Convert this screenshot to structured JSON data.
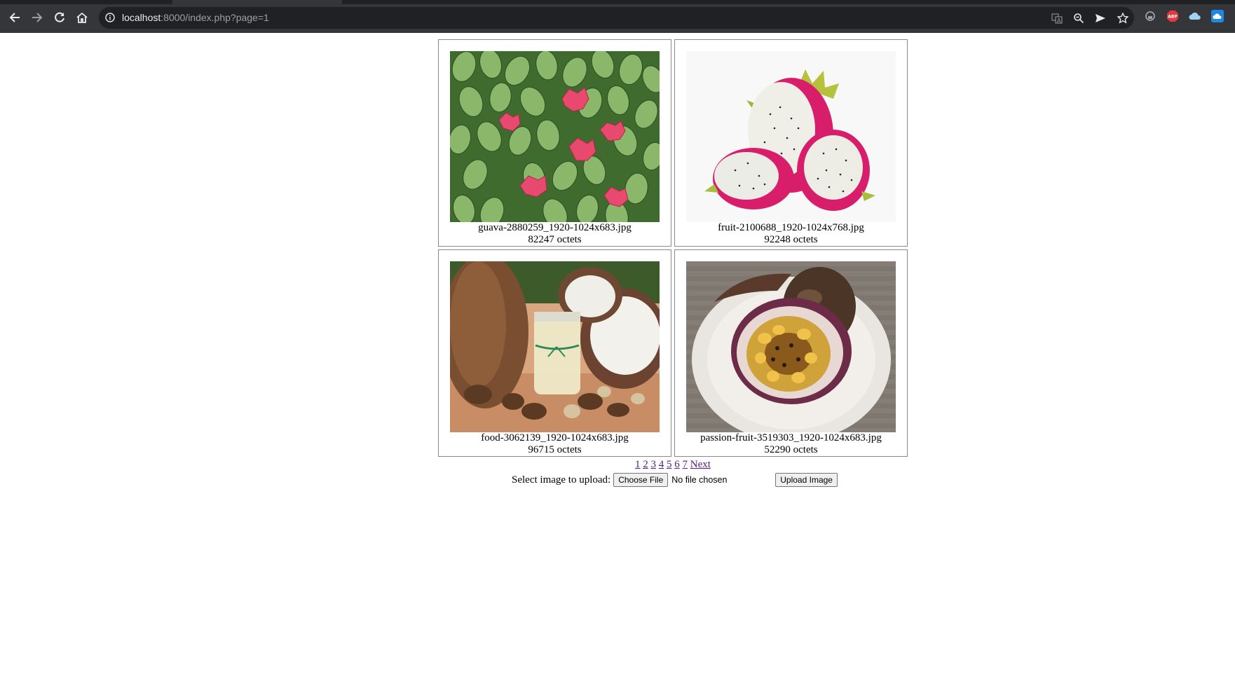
{
  "browser": {
    "url_host": "localhost",
    "url_rest": ":8000/index.php?page=1",
    "icons": [
      "back-icon",
      "forward-icon",
      "reload-icon",
      "home-icon",
      "info-icon",
      "translate-icon",
      "zoom-icon",
      "send-icon",
      "bookmark-star-icon",
      "extension-icon",
      "adblock-icon",
      "cloud-icon",
      "cloud-blue-icon"
    ],
    "abp_label": "ABP"
  },
  "gallery": {
    "items": [
      {
        "filename": "guava-2880259_1920-1024x683.jpg",
        "size": "82247 octets",
        "subject": "guava"
      },
      {
        "filename": "fruit-2100688_1920-1024x768.jpg",
        "size": "92248 octets",
        "subject": "dragon-fruit"
      },
      {
        "filename": "food-3062139_1920-1024x683.jpg",
        "size": "96715 octets",
        "subject": "coconut"
      },
      {
        "filename": "passion-fruit-3519303_1920-1024x683.jpg",
        "size": "52290 octets",
        "subject": "passion-fruit"
      }
    ]
  },
  "pagination": {
    "pages": [
      "1",
      "2",
      "3",
      "4",
      "5",
      "6",
      "7"
    ],
    "next": "Next"
  },
  "upload": {
    "label": "Select image to upload:",
    "choose_button": "Choose File",
    "file_status": "No file chosen",
    "submit_button": "Upload Image"
  }
}
